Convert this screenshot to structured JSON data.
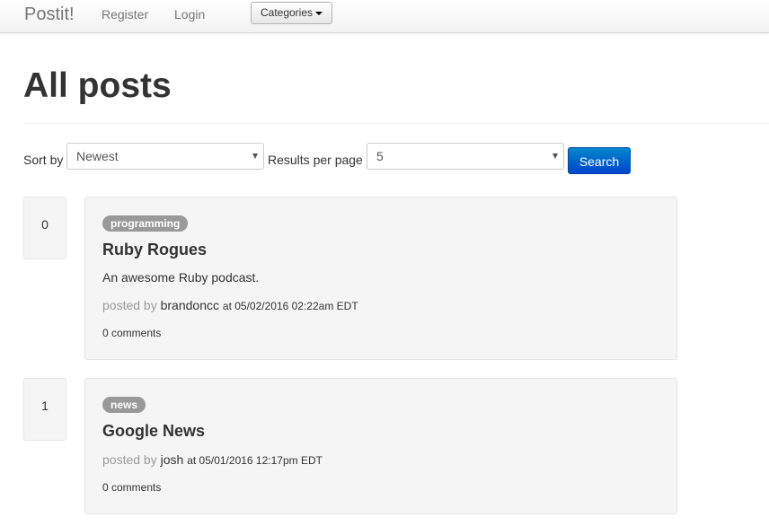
{
  "navbar": {
    "brand": "Postit!",
    "register": "Register",
    "login": "Login",
    "categories": "Categories"
  },
  "page": {
    "title": "All posts"
  },
  "sort_form": {
    "sort_label": "Sort by",
    "sort_value": "Newest",
    "per_page_label": "Results per page",
    "per_page_value": "5",
    "search_label": "Search"
  },
  "posts": [
    {
      "votes": "0",
      "category": "programming",
      "title": "Ruby Rogues",
      "description": "An awesome Ruby podcast.",
      "posted_by": "posted by",
      "author": "brandoncc",
      "timestamp": "at 05/02/2016 02:22am EDT",
      "comments": "0 comments"
    },
    {
      "votes": "1",
      "category": "news",
      "title": "Google News",
      "description": "",
      "posted_by": "posted by",
      "author": "josh",
      "timestamp": "at 05/01/2016 12:17pm EDT",
      "comments": "0 comments"
    }
  ],
  "colors": {
    "primary_button": "#0055cc",
    "badge": "#999999",
    "card_background": "#f5f5f5"
  }
}
